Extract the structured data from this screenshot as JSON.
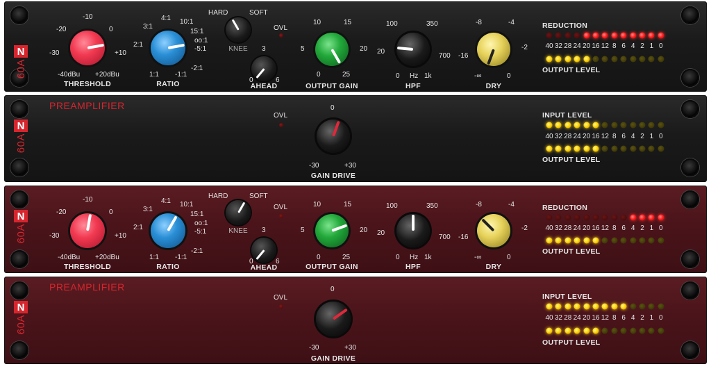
{
  "colors": {
    "brand_red": "#d7252e",
    "threshold_knob": "#f23a52",
    "ratio_knob": "#2a8fd6",
    "output_knob": "#22a83a",
    "dry_knob": "#e6d25a",
    "hpf_knob": "#1a1a1a",
    "knee_knob": "#1a1a1a",
    "ahead_knob": "#1a1a1a",
    "drive_knob": "#1a1a1a"
  },
  "logo": {
    "n": "N",
    "model": "60A"
  },
  "meter_scale": [
    "40",
    "32",
    "28",
    "24",
    "20",
    "16",
    "12",
    "8",
    "6",
    "4",
    "2",
    "1",
    "0"
  ],
  "units": [
    {
      "type": "compressor",
      "threshold": {
        "label": "THRESHOLD",
        "marks": {
          "m20": "-20",
          "m10": "-10",
          "z": "0",
          "m30": "-30",
          "p10": "+10",
          "lo": "-40dBu",
          "hi": "+20dBu"
        }
      },
      "ratio": {
        "label": "RATIO",
        "marks": {
          "r31": "3:1",
          "r41": "4:1",
          "r101": "10:1",
          "r151": "15:1",
          "rinf": "oo:1",
          "rm51": "-5:1",
          "r21": "2:1",
          "rm21": "-2:1",
          "r11": "1:1",
          "rm11": "-1:1"
        }
      },
      "knee": {
        "label": "KNEE",
        "hard": "HARD",
        "soft": "SOFT"
      },
      "ahead": {
        "label": "AHEAD",
        "marks": {
          "z": "0",
          "three": "3",
          "six": "6"
        }
      },
      "ovl": "OVL",
      "output_gain": {
        "label": "OUTPUT GAIN",
        "marks": {
          "ten": "10",
          "fifteen": "15",
          "five": "5",
          "twenty": "20",
          "zero": "0",
          "twentyfive": "25"
        }
      },
      "hpf": {
        "label": "HPF",
        "marks": {
          "hundred": "100",
          "threefifty": "350",
          "twenty": "20",
          "sevenhundred": "700",
          "zero": "0",
          "hz": "Hz",
          "onek": "1k"
        }
      },
      "dry": {
        "label": "DRY",
        "marks": {
          "m8": "-8",
          "m4": "-4",
          "m16": "-16",
          "m2": "-2",
          "minf": "-∞",
          "zero": "0"
        }
      },
      "meter_top_label": "REDUCTION",
      "meter_bottom_label": "OUTPUT LEVEL",
      "top_leds_lit": 9,
      "bottom_leds_lit": 5
    },
    {
      "type": "preamp",
      "title": "PREAMPLIFIER",
      "ovl": "OVL",
      "drive": {
        "label": "GAIN DRIVE",
        "marks": {
          "zero": "0",
          "lo": "-30",
          "hi": "+30"
        }
      },
      "meter_top_label": "INPUT LEVEL",
      "meter_bottom_label": "OUTPUT LEVEL",
      "top_leds_lit": 6,
      "bottom_leds_lit": 6
    },
    {
      "type": "compressor",
      "threshold": {
        "label": "THRESHOLD",
        "marks": {
          "m20": "-20",
          "m10": "-10",
          "z": "0",
          "m30": "-30",
          "p10": "+10",
          "lo": "-40dBu",
          "hi": "+20dBu"
        }
      },
      "ratio": {
        "label": "RATIO",
        "marks": {
          "r31": "3:1",
          "r41": "4:1",
          "r101": "10:1",
          "r151": "15:1",
          "rinf": "oo:1",
          "rm51": "-5:1",
          "r21": "2:1",
          "rm21": "-2:1",
          "r11": "1:1",
          "rm11": "-1:1"
        }
      },
      "knee": {
        "label": "KNEE",
        "hard": "HARD",
        "soft": "SOFT"
      },
      "ahead": {
        "label": "AHEAD",
        "marks": {
          "z": "0",
          "three": "3",
          "six": "6"
        }
      },
      "ovl": "OVL",
      "output_gain": {
        "label": "OUTPUT GAIN",
        "marks": {
          "ten": "10",
          "fifteen": "15",
          "five": "5",
          "twenty": "20",
          "zero": "0",
          "twentyfive": "25"
        }
      },
      "hpf": {
        "label": "HPF",
        "marks": {
          "hundred": "100",
          "threefifty": "350",
          "twenty": "20",
          "sevenhundred": "700",
          "zero": "0",
          "hz": "Hz",
          "onek": "1k"
        }
      },
      "dry": {
        "label": "DRY",
        "marks": {
          "m8": "-8",
          "m4": "-4",
          "m16": "-16",
          "m2": "-2",
          "minf": "-∞",
          "zero": "0"
        }
      },
      "meter_top_label": "REDUCTION",
      "meter_bottom_label": "OUTPUT LEVEL",
      "top_leds_lit": 4,
      "bottom_leds_lit": 6
    },
    {
      "type": "preamp",
      "title": "PREAMPLIFIER",
      "ovl": "OVL",
      "drive": {
        "label": "GAIN DRIVE",
        "marks": {
          "zero": "0",
          "lo": "-30",
          "hi": "+30"
        }
      },
      "meter_top_label": "INPUT LEVEL",
      "meter_bottom_label": "OUTPUT LEVEL",
      "top_leds_lit": 9,
      "bottom_leds_lit": 6
    }
  ]
}
